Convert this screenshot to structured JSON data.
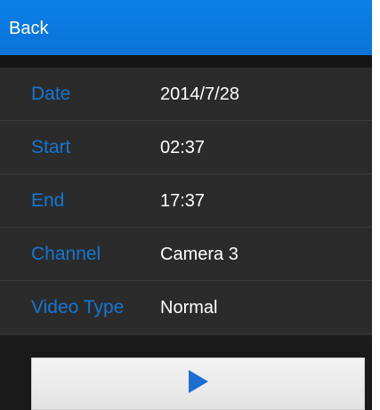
{
  "header": {
    "back_label": "Back",
    "color": "#0b78e0"
  },
  "fields": [
    {
      "label": "Date",
      "value": "2014/7/28"
    },
    {
      "label": "Start",
      "value": "02:37"
    },
    {
      "label": "End",
      "value": "17:37"
    },
    {
      "label": "Channel",
      "value": "Camera 3"
    },
    {
      "label": "Video Type",
      "value": "Normal"
    }
  ],
  "play_button": {
    "icon": "play-icon",
    "icon_color": "#1a6fd0"
  },
  "colors": {
    "label_color": "#1577d4",
    "value_color": "#ffffff",
    "background": "#2b2b2b"
  }
}
